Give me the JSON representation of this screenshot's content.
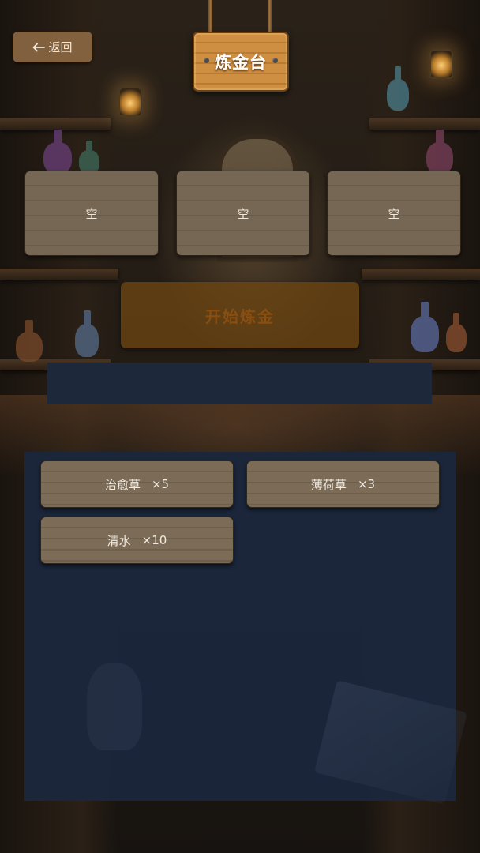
{
  "header": {
    "title": "炼金台",
    "back_label": "返回",
    "back_icon": "left-arrow-icon"
  },
  "slots": [
    {
      "label": "空"
    },
    {
      "label": "空"
    },
    {
      "label": "空"
    }
  ],
  "actions": {
    "start_label": "开始炼金"
  },
  "inventory": {
    "items": [
      {
        "name": "治愈草",
        "count": "×5"
      },
      {
        "name": "薄荷草",
        "count": "×3"
      },
      {
        "name": "清水",
        "count": "×10"
      }
    ]
  },
  "colors": {
    "panel": "#1b273c",
    "start_button": "#72481a",
    "sign": "#cf8f43"
  }
}
